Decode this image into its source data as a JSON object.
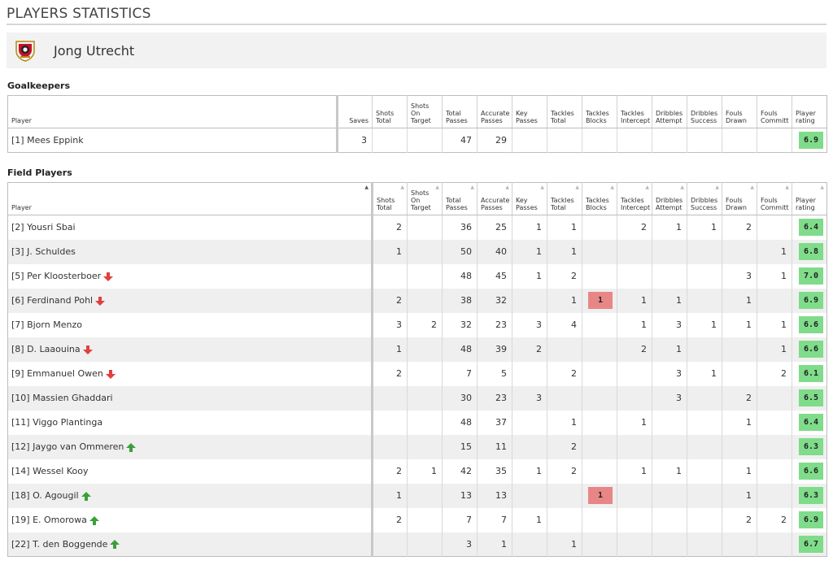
{
  "page_title": "PLAYERS STATISTICS",
  "team": {
    "name": "Jong Utrecht"
  },
  "goalkeepers": {
    "label": "Goalkeepers",
    "columns": [
      "Player",
      "Saves",
      "Shots\nTotal",
      "Shots\nOn\nTarget",
      "Total\nPasses",
      "Accurate\nPasses",
      "Key\nPasses",
      "Tackles\nTotal",
      "Tackles\nBlocks",
      "Tackles\nIntercept",
      "Dribbles\nAttempt",
      "Dribbles\nSuccess",
      "Fouls\nDrawn",
      "Fouls\nCommitt",
      "Player\nrating"
    ],
    "rows": [
      {
        "player": "[1] Mees Eppink",
        "saves": "3",
        "shots_total": "",
        "shots_on": "",
        "total_passes": "47",
        "accurate_passes": "29",
        "key_passes": "",
        "tackles_total": "",
        "tackles_blocks": "",
        "tackles_intercept": "",
        "dribbles_attempt": "",
        "dribbles_success": "",
        "fouls_drawn": "",
        "fouls_committed": "",
        "rating": "6.9"
      }
    ]
  },
  "field_players": {
    "label": "Field Players",
    "columns": [
      "Player",
      "Shots\nTotal",
      "Shots\nOn\nTarget",
      "Total\nPasses",
      "Accurate\nPasses",
      "Key\nPasses",
      "Tackles\nTotal",
      "Tackles\nBlocks",
      "Tackles\nIntercept",
      "Dribbles\nAttempt",
      "Dribbles\nSuccess",
      "Fouls\nDrawn",
      "Fouls\nCommitt",
      "Player\nrating"
    ],
    "rows": [
      {
        "player": "[2] Yousri Sbai",
        "sub": "",
        "shots_total": "2",
        "shots_on": "",
        "total_passes": "36",
        "accurate_passes": "25",
        "key_passes": "1",
        "tackles_total": "1",
        "tackles_blocks": "",
        "tackles_intercept": "2",
        "dribbles_attempt": "1",
        "dribbles_success": "1",
        "fouls_drawn": "2",
        "fouls_committed": "",
        "rating": "6.4"
      },
      {
        "player": "[3] J. Schuldes",
        "sub": "",
        "shots_total": "1",
        "shots_on": "",
        "total_passes": "50",
        "accurate_passes": "40",
        "key_passes": "1",
        "tackles_total": "1",
        "tackles_blocks": "",
        "tackles_intercept": "",
        "dribbles_attempt": "",
        "dribbles_success": "",
        "fouls_drawn": "",
        "fouls_committed": "1",
        "rating": "6.8"
      },
      {
        "player": "[5] Per Kloosterboer",
        "sub": "out",
        "shots_total": "",
        "shots_on": "",
        "total_passes": "48",
        "accurate_passes": "45",
        "key_passes": "1",
        "tackles_total": "2",
        "tackles_blocks": "",
        "tackles_intercept": "",
        "dribbles_attempt": "",
        "dribbles_success": "",
        "fouls_drawn": "3",
        "fouls_committed": "1",
        "rating": "7.0"
      },
      {
        "player": "[6] Ferdinand Pohl",
        "sub": "out",
        "shots_total": "2",
        "shots_on": "",
        "total_passes": "38",
        "accurate_passes": "32",
        "key_passes": "",
        "tackles_total": "1",
        "tackles_blocks": "1",
        "tackles_intercept": "1",
        "dribbles_attempt": "1",
        "dribbles_success": "",
        "fouls_drawn": "1",
        "fouls_committed": "",
        "rating": "6.9"
      },
      {
        "player": "[7] Bjorn Menzo",
        "sub": "",
        "shots_total": "3",
        "shots_on": "2",
        "total_passes": "32",
        "accurate_passes": "23",
        "key_passes": "3",
        "tackles_total": "4",
        "tackles_blocks": "",
        "tackles_intercept": "1",
        "dribbles_attempt": "3",
        "dribbles_success": "1",
        "fouls_drawn": "1",
        "fouls_committed": "1",
        "rating": "6.6"
      },
      {
        "player": "[8] D. Laaouina",
        "sub": "out",
        "shots_total": "1",
        "shots_on": "",
        "total_passes": "48",
        "accurate_passes": "39",
        "key_passes": "2",
        "tackles_total": "",
        "tackles_blocks": "",
        "tackles_intercept": "2",
        "dribbles_attempt": "1",
        "dribbles_success": "",
        "fouls_drawn": "",
        "fouls_committed": "1",
        "rating": "6.6"
      },
      {
        "player": "[9] Emmanuel Owen",
        "sub": "out",
        "shots_total": "2",
        "shots_on": "",
        "total_passes": "7",
        "accurate_passes": "5",
        "key_passes": "",
        "tackles_total": "2",
        "tackles_blocks": "",
        "tackles_intercept": "",
        "dribbles_attempt": "3",
        "dribbles_success": "1",
        "fouls_drawn": "",
        "fouls_committed": "2",
        "rating": "6.1"
      },
      {
        "player": "[10] Massien Ghaddari",
        "sub": "",
        "shots_total": "",
        "shots_on": "",
        "total_passes": "30",
        "accurate_passes": "23",
        "key_passes": "3",
        "tackles_total": "",
        "tackles_blocks": "",
        "tackles_intercept": "",
        "dribbles_attempt": "3",
        "dribbles_success": "",
        "fouls_drawn": "2",
        "fouls_committed": "",
        "rating": "6.5"
      },
      {
        "player": "[11] Viggo Plantinga",
        "sub": "",
        "shots_total": "",
        "shots_on": "",
        "total_passes": "48",
        "accurate_passes": "37",
        "key_passes": "",
        "tackles_total": "1",
        "tackles_blocks": "",
        "tackles_intercept": "1",
        "dribbles_attempt": "",
        "dribbles_success": "",
        "fouls_drawn": "1",
        "fouls_committed": "",
        "rating": "6.4"
      },
      {
        "player": "[12] Jaygo van Ommeren",
        "sub": "in",
        "shots_total": "",
        "shots_on": "",
        "total_passes": "15",
        "accurate_passes": "11",
        "key_passes": "",
        "tackles_total": "2",
        "tackles_blocks": "",
        "tackles_intercept": "",
        "dribbles_attempt": "",
        "dribbles_success": "",
        "fouls_drawn": "",
        "fouls_committed": "",
        "rating": "6.3"
      },
      {
        "player": "[14] Wessel Kooy",
        "sub": "",
        "shots_total": "2",
        "shots_on": "1",
        "total_passes": "42",
        "accurate_passes": "35",
        "key_passes": "1",
        "tackles_total": "2",
        "tackles_blocks": "",
        "tackles_intercept": "1",
        "dribbles_attempt": "1",
        "dribbles_success": "",
        "fouls_drawn": "1",
        "fouls_committed": "",
        "rating": "6.6"
      },
      {
        "player": "[18] O. Agougil",
        "sub": "in",
        "shots_total": "1",
        "shots_on": "",
        "total_passes": "13",
        "accurate_passes": "13",
        "key_passes": "",
        "tackles_total": "",
        "tackles_blocks": "1",
        "tackles_intercept": "",
        "dribbles_attempt": "",
        "dribbles_success": "",
        "fouls_drawn": "1",
        "fouls_committed": "",
        "rating": "6.3"
      },
      {
        "player": "[19] E. Omorowa",
        "sub": "in",
        "shots_total": "2",
        "shots_on": "",
        "total_passes": "7",
        "accurate_passes": "7",
        "key_passes": "1",
        "tackles_total": "",
        "tackles_blocks": "",
        "tackles_intercept": "",
        "dribbles_attempt": "",
        "dribbles_success": "",
        "fouls_drawn": "2",
        "fouls_committed": "2",
        "rating": "6.9"
      },
      {
        "player": "[22] T. den Boggende",
        "sub": "in",
        "shots_total": "",
        "shots_on": "",
        "total_passes": "3",
        "accurate_passes": "1",
        "key_passes": "",
        "tackles_total": "1",
        "tackles_blocks": "",
        "tackles_intercept": "",
        "dribbles_attempt": "",
        "dribbles_success": "",
        "fouls_drawn": "",
        "fouls_committed": "",
        "rating": "6.7"
      }
    ]
  },
  "colors": {
    "rating_bg": "#7fdc8a",
    "blocks_bg": "#e88686",
    "sub_out": "#e04040",
    "sub_in": "#3aa03a",
    "row_alt": "#efefef"
  },
  "icons": {
    "team_logo": "fc-utrecht-crest-icon",
    "sub_out": "substitution-out-arrow-icon",
    "sub_in": "substitution-in-arrow-icon",
    "sort": "sort-arrow-icon"
  }
}
